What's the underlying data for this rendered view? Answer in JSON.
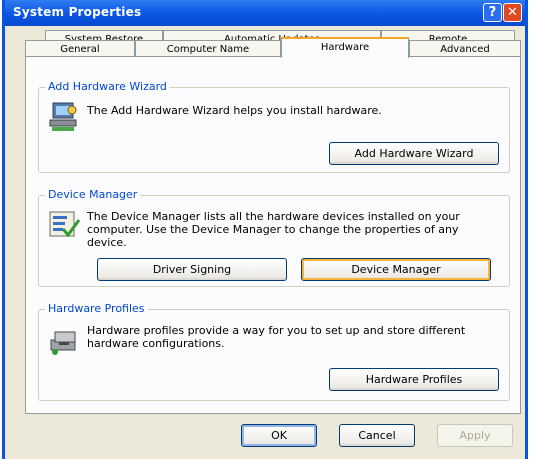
{
  "window": {
    "title": "System Properties",
    "help_glyph": "?",
    "close_glyph": "✕"
  },
  "tabs": {
    "row_top": [
      "System Restore",
      "Automatic Updates",
      "Remote"
    ],
    "row_bottom": [
      "General",
      "Computer Name",
      "Hardware",
      "Advanced"
    ],
    "active": "Hardware"
  },
  "groups": {
    "wizard": {
      "title": "Add Hardware Wizard",
      "icon": "hardware-wizard-icon",
      "description": "The Add Hardware Wizard helps you install hardware.",
      "button": "Add Hardware Wizard"
    },
    "device_manager": {
      "title": "Device Manager",
      "icon": "device-manager-icon",
      "description": "The Device Manager lists all the hardware devices installed on your computer. Use the Device Manager to change the properties of any device.",
      "button_driver": "Driver Signing",
      "button_device": "Device Manager"
    },
    "profiles": {
      "title": "Hardware Profiles",
      "icon": "hardware-profiles-icon",
      "description": "Hardware profiles provide a way for you to set up and store different hardware configurations.",
      "button": "Hardware Profiles"
    }
  },
  "footer": {
    "ok": "OK",
    "cancel": "Cancel",
    "apply": "Apply"
  },
  "colors": {
    "titlebar": "#0b55e3",
    "dialog_bg": "#ece9d8",
    "tab_highlight": "#f5a623",
    "group_title": "#0046d5"
  }
}
